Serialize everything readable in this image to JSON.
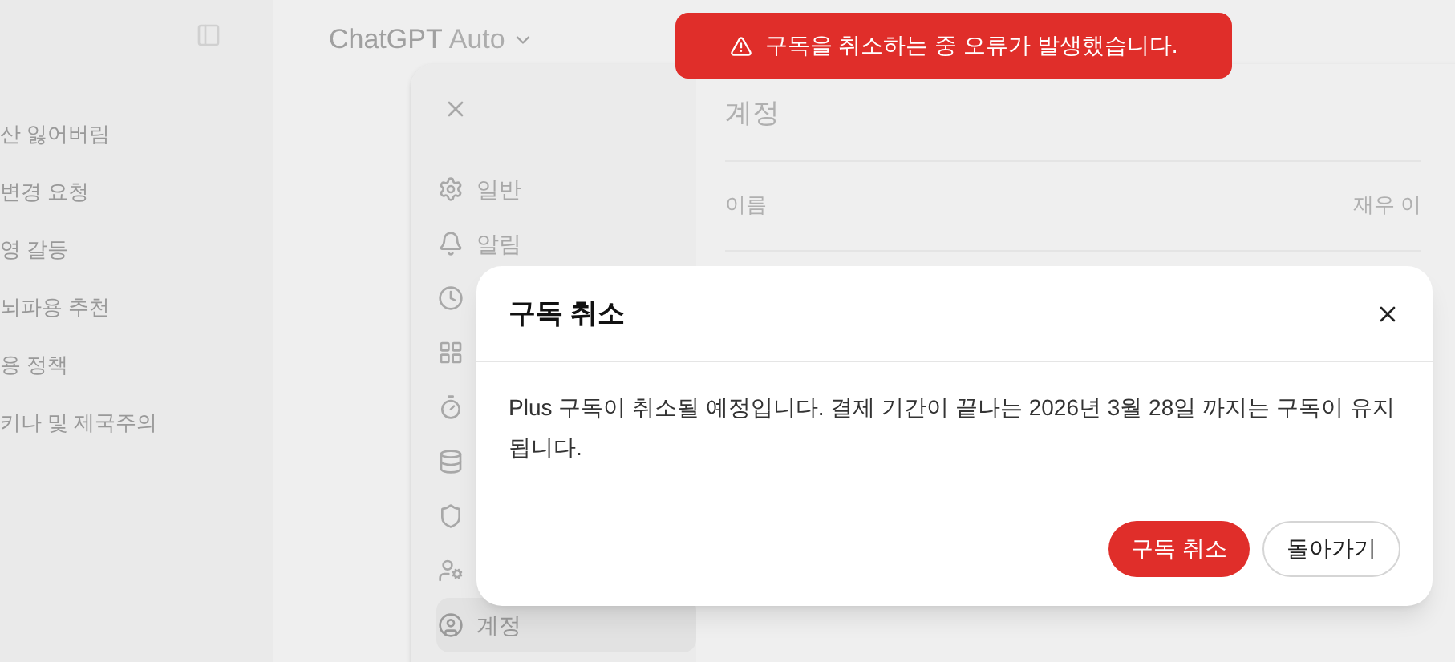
{
  "sidebar": {
    "items": [
      "산 잃어버림",
      "변경 요청",
      "영 갈등",
      "뇌파용 추천",
      "용 정책",
      "키나 및 제국주의"
    ]
  },
  "header": {
    "title": "ChatGPT",
    "model": "Auto"
  },
  "toast": {
    "message": "구독을 취소하는 중 오류가 발생했습니다."
  },
  "settings": {
    "nav": [
      {
        "label": "일반",
        "kind": "gear",
        "selected": false
      },
      {
        "label": "알림",
        "kind": "bell",
        "selected": false
      },
      {
        "kind": "clock",
        "selected": false
      },
      {
        "kind": "apps",
        "selected": false
      },
      {
        "kind": "timer",
        "selected": false
      },
      {
        "kind": "database",
        "selected": false
      },
      {
        "kind": "shield",
        "selected": false
      },
      {
        "kind": "person",
        "selected": false
      },
      {
        "label": "계정",
        "kind": "account",
        "selected": true
      }
    ],
    "title": "계정",
    "rows": [
      {
        "label": "이름",
        "value": "재우 이"
      }
    ]
  },
  "dialog": {
    "title": "구독 취소",
    "message": "Plus 구독이 취소될 예정입니다. 결제 기간이 끝나는 2026년 3월 28일 까지는 구독이 유지됩니다.",
    "buttons": [
      {
        "label": "구독 취소",
        "kind": "danger"
      },
      {
        "label": "돌아가기",
        "kind": "secondary"
      }
    ]
  }
}
